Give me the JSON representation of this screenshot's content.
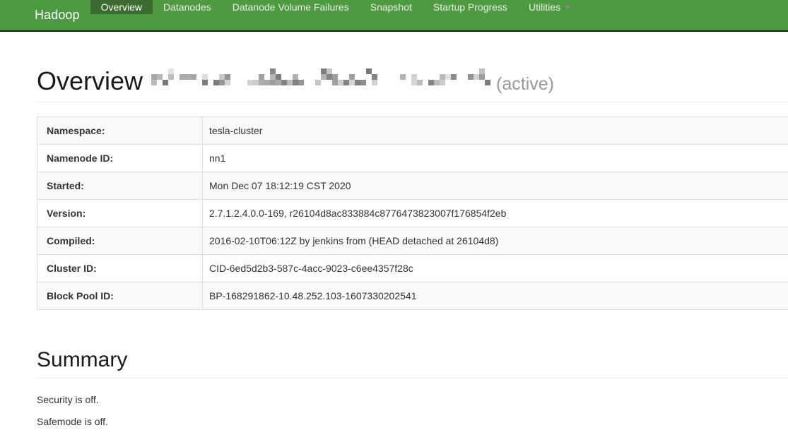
{
  "navbar": {
    "brand": "Hadoop",
    "background_color": "#4e9a41",
    "active_background_color": "#3b6b2e",
    "items": [
      {
        "label": "Overview",
        "active": true,
        "has_caret": false
      },
      {
        "label": "Datanodes",
        "active": false,
        "has_caret": false
      },
      {
        "label": "Datanode Volume Failures",
        "active": false,
        "has_caret": false
      },
      {
        "label": "Snapshot",
        "active": false,
        "has_caret": false
      },
      {
        "label": "Startup Progress",
        "active": false,
        "has_caret": false
      },
      {
        "label": "Utilities",
        "active": false,
        "has_caret": true
      }
    ]
  },
  "page": {
    "title": "Overview",
    "redacted_note": "host:port redacted / pixelated",
    "title_suffix": "(active)"
  },
  "info_table": {
    "rows": [
      {
        "key": "Namespace:",
        "value": "tesla-cluster"
      },
      {
        "key": "Namenode ID:",
        "value": "nn1"
      },
      {
        "key": "Started:",
        "value": "Mon Dec 07 18:12:19 CST 2020"
      },
      {
        "key": "Version:",
        "value": "2.7.1.2.4.0.0-169, r26104d8ac833884c8776473823007f176854f2eb"
      },
      {
        "key": "Compiled:",
        "value": "2016-02-10T06:12Z by jenkins from (HEAD detached at 26104d8)"
      },
      {
        "key": "Cluster ID:",
        "value": "CID-6ed5d2b3-587c-4acc-9023-c6ee4357f28c"
      },
      {
        "key": "Block Pool ID:",
        "value": "BP-168291862-10.48.252.103-1607330202541"
      }
    ]
  },
  "summary": {
    "title": "Summary",
    "lines": [
      "Security is off.",
      "Safemode is off."
    ]
  }
}
